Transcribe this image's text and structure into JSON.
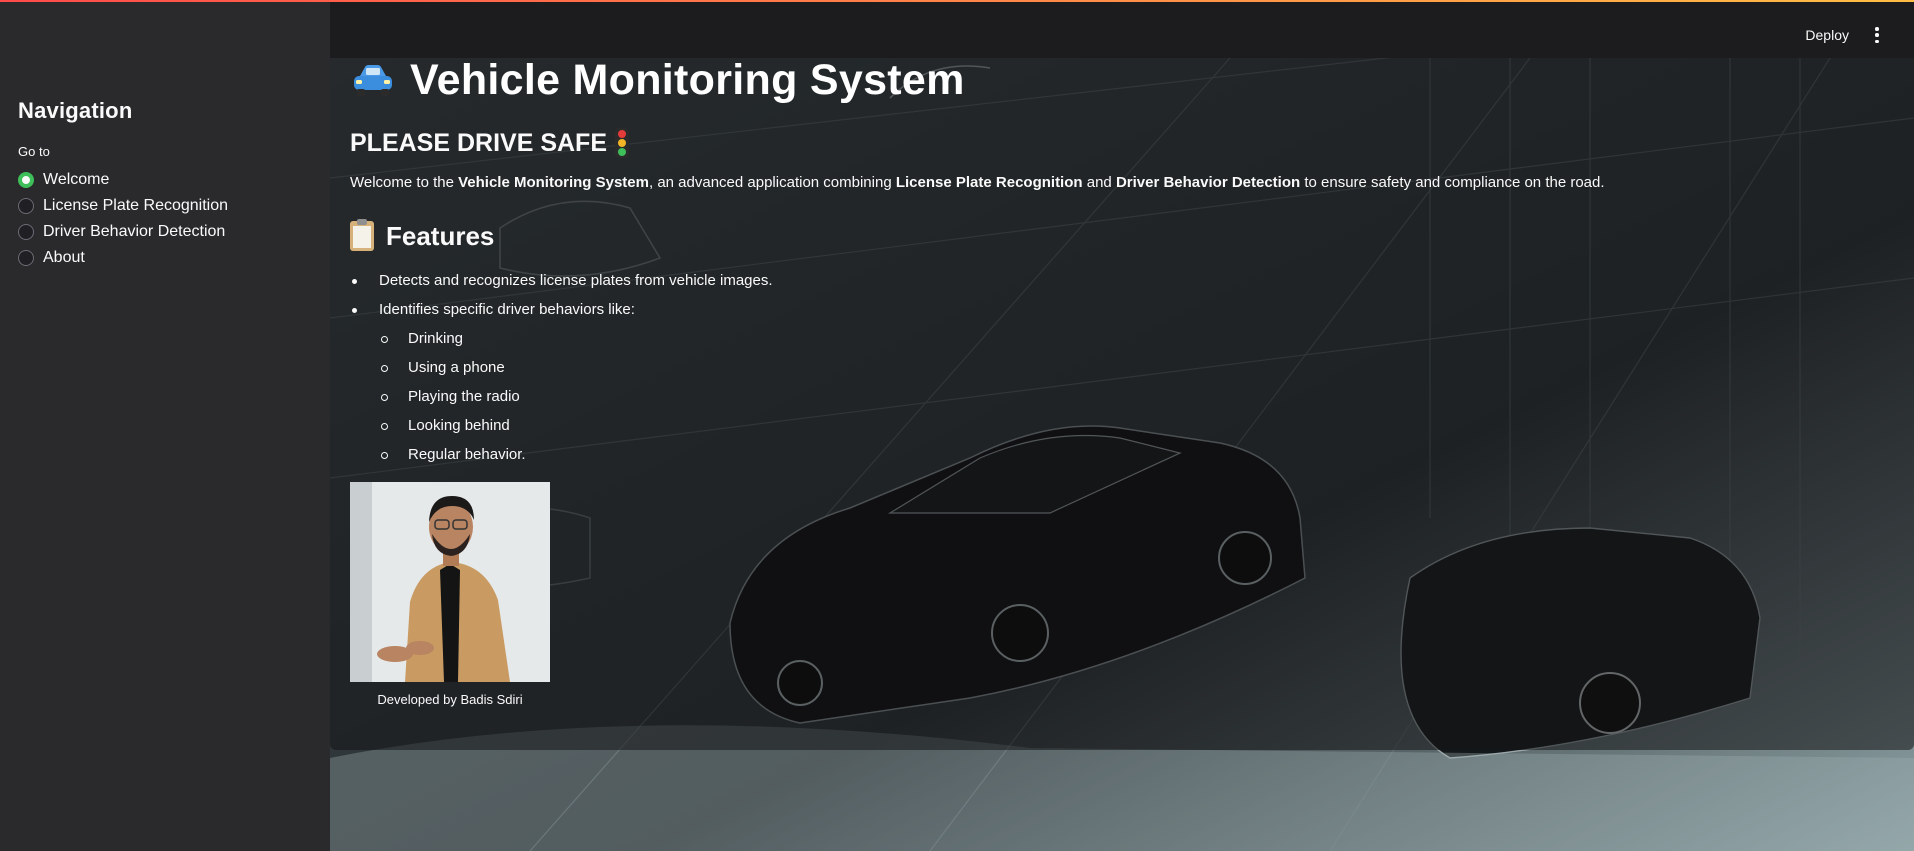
{
  "sidebar": {
    "title": "Navigation",
    "group_label": "Go to",
    "options": [
      {
        "label": "Welcome",
        "selected": true
      },
      {
        "label": "License Plate Recognition",
        "selected": false
      },
      {
        "label": "Driver Behavior Detection",
        "selected": false
      },
      {
        "label": "About",
        "selected": false
      }
    ]
  },
  "header": {
    "deploy_label": "Deploy",
    "menu_icon": "kebab-menu-icon"
  },
  "main": {
    "title": "Vehicle Monitoring System",
    "title_icon": "car-emoji-icon",
    "subtitle": "PLEASE DRIVE SAFE",
    "subtitle_icon": "traffic-light-icon",
    "intro": {
      "p1": "Welcome to the ",
      "b1": "Vehicle Monitoring System",
      "p2": ", an advanced application combining ",
      "b2": "License Plate Recognition",
      "p3": " and ",
      "b3": "Driver Behavior Detection",
      "p4": " to ensure safety and compliance on the road."
    },
    "features_heading": "Features",
    "features_icon": "clipboard-icon",
    "features": [
      "Detects and recognizes license plates from vehicle images.",
      "Identifies specific driver behaviors like:"
    ],
    "behaviors": [
      "Drinking",
      "Using a phone",
      "Playing the radio",
      "Looking behind",
      "Regular behavior."
    ],
    "caption": "Developed by Badis Sdiri"
  },
  "colors": {
    "accent_radio": "#3fbf5a",
    "sidebar_bg": "#2a2a2c",
    "header_bg": "#1c1c1e",
    "top_bar_gradient_start": "#ff4b4b",
    "top_bar_gradient_end": "#ffbd45"
  }
}
